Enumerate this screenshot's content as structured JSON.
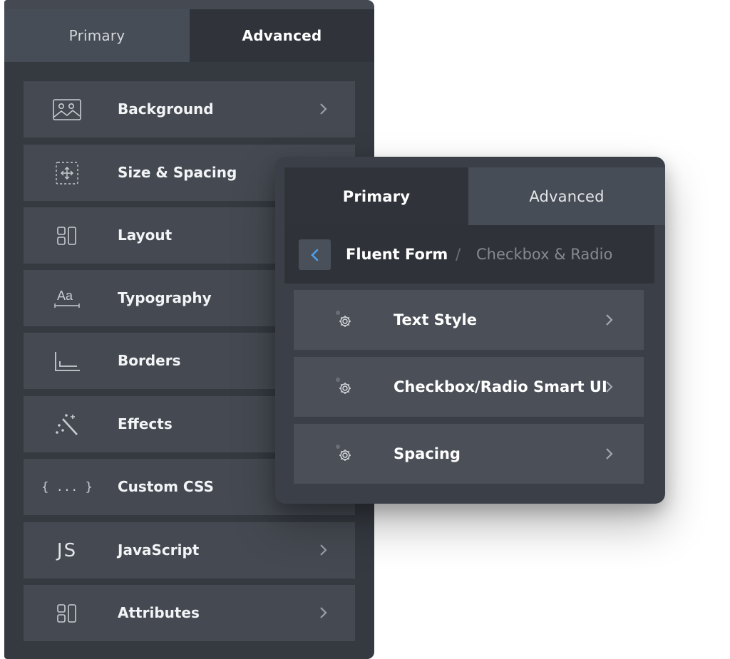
{
  "back_panel": {
    "tabs": {
      "primary": "Primary",
      "advanced": "Advanced"
    },
    "items": [
      {
        "label": "Background",
        "icon": "image-icon"
      },
      {
        "label": "Size & Spacing",
        "icon": "move-icon"
      },
      {
        "label": "Layout",
        "icon": "layout-icon"
      },
      {
        "label": "Typography",
        "icon": "typography-icon"
      },
      {
        "label": "Borders",
        "icon": "borders-icon"
      },
      {
        "label": "Effects",
        "icon": "magic-wand-icon"
      },
      {
        "label": "Custom CSS",
        "icon": "code-braces-icon",
        "icon_text": "{ ... }"
      },
      {
        "label": "JavaScript",
        "icon": "javascript-icon",
        "icon_text": "JS"
      },
      {
        "label": "Attributes",
        "icon": "layout-icon"
      }
    ]
  },
  "front_panel": {
    "tabs": {
      "primary": "Primary",
      "advanced": "Advanced"
    },
    "breadcrumb": {
      "current": "Fluent Form",
      "separator": "/",
      "next": "Checkbox & Radio"
    },
    "items": [
      {
        "label": "Text Style",
        "icon": "gear-icon"
      },
      {
        "label": "Checkbox/Radio Smart UI",
        "icon": "gear-icon"
      },
      {
        "label": "Spacing",
        "icon": "gear-icon"
      }
    ]
  },
  "colors": {
    "panel_bg": "#353a41",
    "item_bg": "#454a52",
    "active_tab_bg": "#30343a",
    "accent_blue": "#4a9ff0"
  }
}
